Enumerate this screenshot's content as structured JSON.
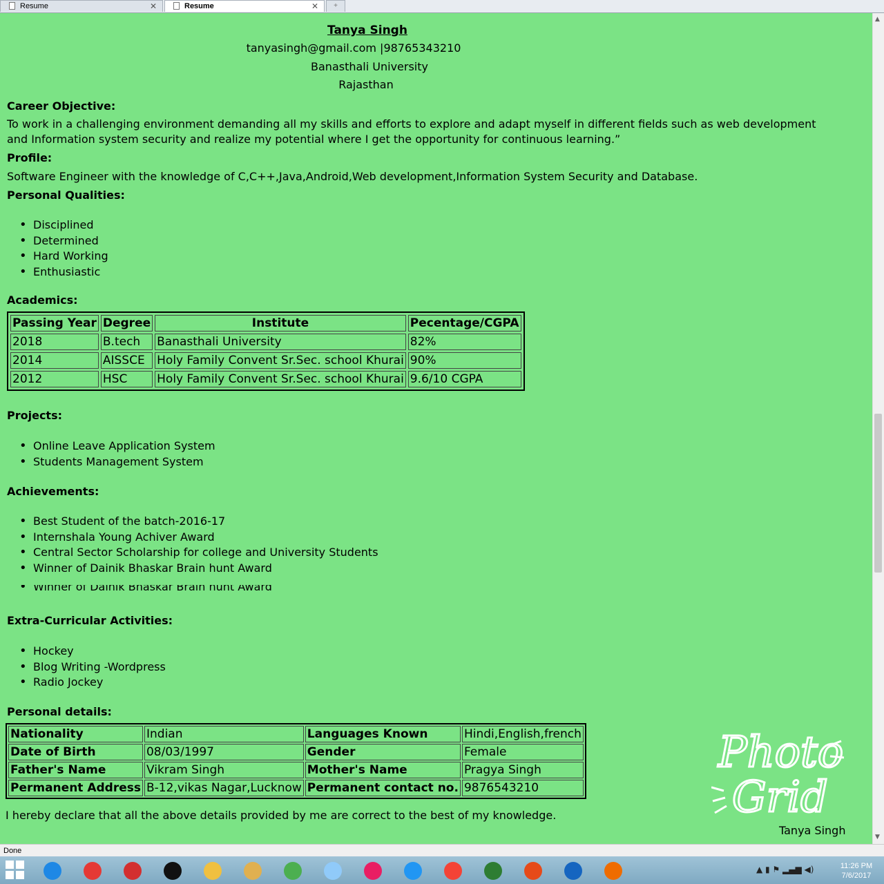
{
  "browser": {
    "tabs": [
      {
        "label": "Resume",
        "active": false
      },
      {
        "label": "Resume",
        "active": true
      }
    ],
    "new_tab_glyph": "+",
    "status_text": "Done"
  },
  "resume": {
    "name": "Tanya Singh",
    "contact": "tanyasingh@gmail.com |98765343210",
    "university": "Banasthali University",
    "state": "Rajasthan",
    "career_objective_heading": "Career Objective:",
    "career_objective_text": "To work in a challenging environment demanding all my skills and efforts to explore and adapt myself in different fields such as web development and Information system security and realize my potential where I get the opportunity for continuous learning.”",
    "profile_heading": "Profile:",
    "profile_text": "Software Engineer with the knowledge of C,C++,Java,Android,Web development,Information System Security and Database.",
    "qualities_heading": "Personal Qualities:",
    "qualities": [
      "Disciplined",
      "Determined",
      "Hard Working",
      "Enthusiastic"
    ],
    "academics_heading": "Academics:",
    "academics": {
      "headers": [
        "Passing Year",
        "Degree",
        "Institute",
        "Pecentage/CGPA"
      ],
      "rows": [
        [
          "2018",
          "B.tech",
          "Banasthali University",
          "82%"
        ],
        [
          "2014",
          "AISSCE",
          "Holy Family Convent Sr.Sec. school Khurai",
          "90%"
        ],
        [
          "2012",
          "HSC",
          "Holy Family Convent Sr.Sec. school Khurai",
          "9.6/10 CGPA"
        ]
      ]
    },
    "projects_heading": "Projects:",
    "projects": [
      "Online Leave Application System",
      "Students Management System"
    ],
    "achievements_heading": "Achievements:",
    "achievements": [
      "Best Student of the batch-2016-17",
      "Internshala Young Achiver Award",
      "Central Sector Scholarship for college and University Students",
      "Winner of Dainik Bhaskar Brain hunt Award"
    ],
    "achievement_repeat": "Winner of Dainik Bhaskar Brain hunt Award",
    "extra_heading": "Extra-Curricular Activities:",
    "extra": [
      "Hockey",
      "Blog Writing -Wordpress",
      "Radio Jockey"
    ],
    "personal_heading": "Personal details:",
    "personal": [
      [
        "Nationality",
        "Indian",
        "Languages Known",
        "Hindi,English,french"
      ],
      [
        "Date of Birth",
        "08/03/1997",
        "Gender",
        "Female"
      ],
      [
        "Father's Name",
        "Vikram Singh",
        "Mother's Name",
        "Pragya Singh"
      ],
      [
        "Permanent Address",
        "B-12,vikas Nagar,Lucknow",
        "Permanent contact no.",
        "9876543210"
      ]
    ],
    "declaration": "I hereby declare that all the above details provided by me are correct to the best of my knowledge."
  },
  "watermark": {
    "logo_text_1": "Photo",
    "logo_text_2": "Grid",
    "signature_name": "Tanya Singh"
  },
  "taskbar": {
    "apps": [
      {
        "name": "internet-explorer-icon",
        "color": "#1e88e5"
      },
      {
        "name": "chrome-icon",
        "color": "#e53935"
      },
      {
        "name": "opera-icon",
        "color": "#d32f2f"
      },
      {
        "name": "command-prompt-icon",
        "color": "#111111"
      },
      {
        "name": "file-manager-icon",
        "color": "#f0c040"
      },
      {
        "name": "folder-icon",
        "color": "#e0b050"
      },
      {
        "name": "android-studio-icon",
        "color": "#4caf50"
      },
      {
        "name": "notepad-icon",
        "color": "#90caf9"
      },
      {
        "name": "slack-icon",
        "color": "#e91e63"
      },
      {
        "name": "winscp-icon",
        "color": "#2196f3"
      },
      {
        "name": "yandex-browser-icon",
        "color": "#f44336"
      },
      {
        "name": "excel-icon",
        "color": "#2e7d32"
      },
      {
        "name": "office-upload-icon",
        "color": "#e64a19"
      },
      {
        "name": "virtualbox-icon",
        "color": "#1565c0"
      },
      {
        "name": "firefox-icon",
        "color": "#ef6c00"
      }
    ],
    "time": "11:26 PM",
    "date": "7/6/2017"
  }
}
